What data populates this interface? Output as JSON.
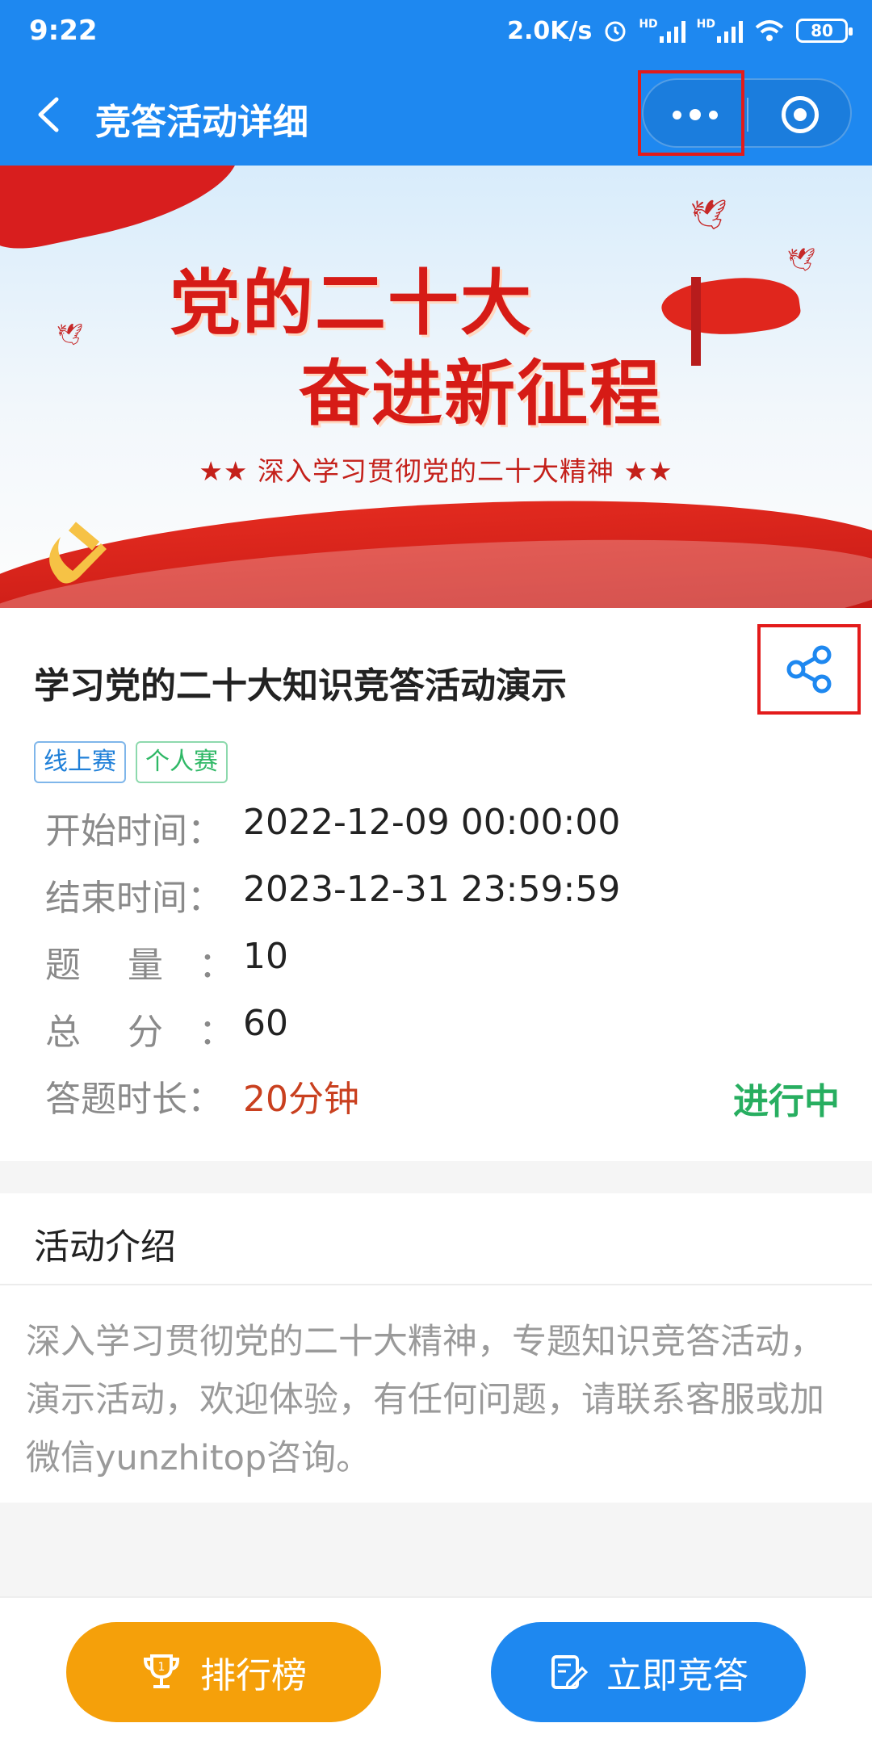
{
  "status_bar": {
    "time": "9:22",
    "speed": "2.0K/s",
    "hd1": "HD",
    "hd2": "HD",
    "battery": "80"
  },
  "nav": {
    "title": "竞答活动详细"
  },
  "banner": {
    "title_line1": "党的二十大",
    "title_line2": "奋进新征程",
    "subtitle": "★★ 深入学习贯彻党的二十大精神 ★★"
  },
  "activity": {
    "title": "学习党的二十大知识竞答活动演示",
    "tags": [
      "线上赛",
      "个人赛"
    ],
    "fields": [
      {
        "label": "开始时间：",
        "value": "2022-12-09 00:00:00"
      },
      {
        "label": "结束时间：",
        "value": "2023-12-31 23:59:59"
      },
      {
        "label": "题　 量　：",
        "value": "10"
      },
      {
        "label": "总　 分　：",
        "value": "60"
      },
      {
        "label": "答题时长：",
        "value": "20分钟"
      }
    ],
    "status": "进行中"
  },
  "intro": {
    "heading": "活动介绍",
    "text": "深入学习贯彻党的二十大精神，专题知识竞答活动，演示活动，欢迎体验，有任何问题，请联系客服或加微信yunzhitop咨询。"
  },
  "buttons": {
    "rank_label": "排行榜",
    "start_label": "立即竞答"
  },
  "colors": {
    "primary": "#1e88f0",
    "accent_orange": "#f5a00a",
    "status_green": "#27ae60",
    "duration_red": "#c9401f",
    "highlight_red": "#e31b1b"
  }
}
